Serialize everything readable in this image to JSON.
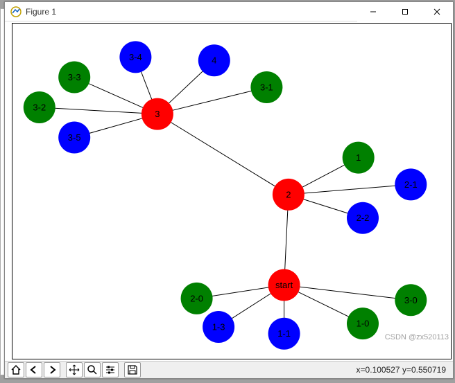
{
  "window": {
    "title": "Figure 1"
  },
  "statusbar": {
    "coords_label": "x=0.100527     y=0.550719"
  },
  "watermark": "CSDN @zx520113",
  "chart_data": {
    "type": "network",
    "title": "",
    "nodes": [
      {
        "id": "start",
        "label": "start",
        "color": "red",
        "x": 0.62,
        "y": 0.22
      },
      {
        "id": "2",
        "label": "2",
        "color": "red",
        "x": 0.63,
        "y": 0.49
      },
      {
        "id": "3",
        "label": "3",
        "color": "red",
        "x": 0.33,
        "y": 0.73
      },
      {
        "id": "4",
        "label": "4",
        "color": "blue",
        "x": 0.46,
        "y": 0.89
      },
      {
        "id": "1",
        "label": "1",
        "color": "green",
        "x": 0.79,
        "y": 0.6
      },
      {
        "id": "2-1",
        "label": "2-1",
        "color": "blue",
        "x": 0.91,
        "y": 0.52
      },
      {
        "id": "2-2",
        "label": "2-2",
        "color": "blue",
        "x": 0.8,
        "y": 0.42
      },
      {
        "id": "2-0",
        "label": "2-0",
        "color": "green",
        "x": 0.42,
        "y": 0.18
      },
      {
        "id": "1-3",
        "label": "1-3",
        "color": "blue",
        "x": 0.47,
        "y": 0.095
      },
      {
        "id": "1-1",
        "label": "1-1",
        "color": "blue",
        "x": 0.62,
        "y": 0.075
      },
      {
        "id": "1-0",
        "label": "1-0",
        "color": "green",
        "x": 0.8,
        "y": 0.105
      },
      {
        "id": "3-0",
        "label": "3-0",
        "color": "green",
        "x": 0.91,
        "y": 0.175
      },
      {
        "id": "3-1",
        "label": "3-1",
        "color": "green",
        "x": 0.58,
        "y": 0.81
      },
      {
        "id": "3-2",
        "label": "3-2",
        "color": "green",
        "x": 0.06,
        "y": 0.75
      },
      {
        "id": "3-3",
        "label": "3-3",
        "color": "green",
        "x": 0.14,
        "y": 0.84
      },
      {
        "id": "3-4",
        "label": "3-4",
        "color": "blue",
        "x": 0.28,
        "y": 0.9
      },
      {
        "id": "3-5",
        "label": "3-5",
        "color": "blue",
        "x": 0.14,
        "y": 0.66
      }
    ],
    "edges": [
      [
        "start",
        "2-0"
      ],
      [
        "start",
        "1-3"
      ],
      [
        "start",
        "1-1"
      ],
      [
        "start",
        "1-0"
      ],
      [
        "start",
        "3-0"
      ],
      [
        "start",
        "2"
      ],
      [
        "2",
        "1"
      ],
      [
        "2",
        "2-1"
      ],
      [
        "2",
        "2-2"
      ],
      [
        "2",
        "3"
      ],
      [
        "3",
        "3-1"
      ],
      [
        "3",
        "3-2"
      ],
      [
        "3",
        "3-3"
      ],
      [
        "3",
        "3-4"
      ],
      [
        "3",
        "3-5"
      ],
      [
        "3",
        "4"
      ]
    ],
    "colors": {
      "red": "#ff0000",
      "green": "#008000",
      "blue": "#0000ff"
    },
    "node_radius": 23,
    "xlim": [
      0,
      1
    ],
    "ylim": [
      0,
      1
    ]
  }
}
